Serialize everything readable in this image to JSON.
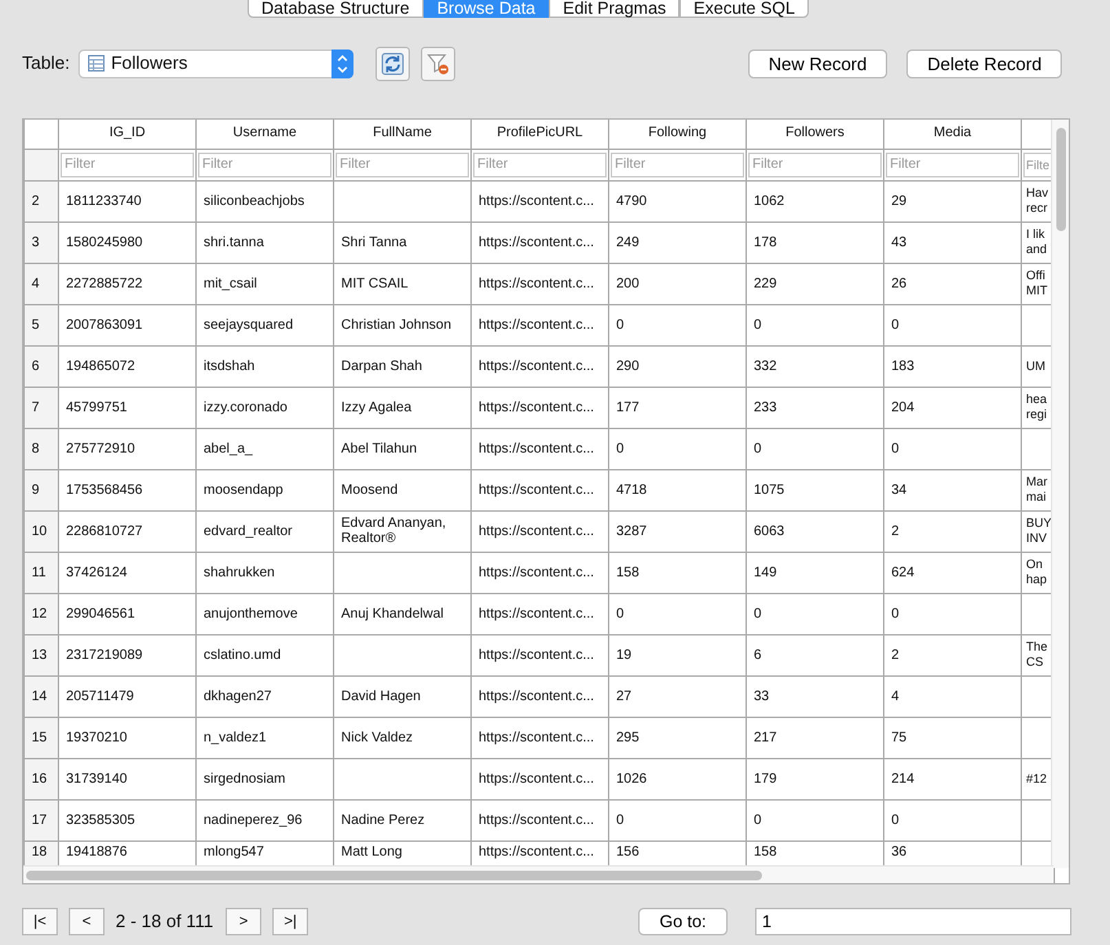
{
  "tabs": [
    {
      "label": "Database Structure",
      "selected": false
    },
    {
      "label": "Browse Data",
      "selected": true
    },
    {
      "label": "Edit Pragmas",
      "selected": false
    },
    {
      "label": "Execute SQL",
      "selected": false
    }
  ],
  "table_picker": {
    "label": "Table:",
    "value": "Followers"
  },
  "buttons": [
    "New Record",
    "Delete Record"
  ],
  "grid": {
    "columns": [
      "IG_ID",
      "Username",
      "FullName",
      "ProfilePicURL",
      "Following",
      "Followers",
      "Media",
      null
    ],
    "filters": [
      {
        "placeholder": "Filter"
      },
      {
        "placeholder": "Filter"
      },
      {
        "placeholder": "Filter"
      },
      {
        "placeholder": "Filter"
      },
      {
        "placeholder": "Filter"
      },
      {
        "placeholder": "Filter"
      },
      {
        "placeholder": "Filter"
      },
      {
        "placeholder": "Filte"
      }
    ],
    "rows": [
      {
        "number": "2",
        "cells": [
          "1811233740",
          "siliconbeachjobs",
          null,
          "https://scontent.c...",
          "4790",
          "1062",
          "29",
          "Hav\nrecr"
        ]
      },
      {
        "number": "3",
        "cells": [
          "1580245980",
          "shri.tanna",
          "Shri Tanna",
          "https://scontent.c...",
          "249",
          "178",
          "43",
          "I lik\nand"
        ]
      },
      {
        "number": "4",
        "cells": [
          "2272885722",
          "mit_csail",
          "MIT CSAIL",
          "https://scontent.c...",
          "200",
          "229",
          "26",
          "Offi\nMIT"
        ]
      },
      {
        "number": "5",
        "cells": [
          "2007863091",
          "seejaysquared",
          "Christian Johnson",
          "https://scontent.c...",
          "0",
          "0",
          "0",
          null
        ]
      },
      {
        "number": "6",
        "cells": [
          "194865072",
          "itsdshah",
          "Darpan Shah",
          "https://scontent.c...",
          "290",
          "332",
          "183",
          "UM"
        ]
      },
      {
        "number": "7",
        "cells": [
          "45799751",
          "izzy.coronado",
          "Izzy Agalea",
          "https://scontent.c...",
          "177",
          "233",
          "204",
          "hea\nregi"
        ]
      },
      {
        "number": "8",
        "cells": [
          "275772910",
          "abel_a_",
          "Abel Tilahun",
          "https://scontent.c...",
          "0",
          "0",
          "0",
          null
        ]
      },
      {
        "number": "9",
        "cells": [
          "1753568456",
          "moosendapp",
          "Moosend",
          "https://scontent.c...",
          "4718",
          "1075",
          "34",
          "Mar\nmai"
        ]
      },
      {
        "number": "10",
        "cells": [
          "2286810727",
          "edvard_realtor",
          "Edvard Ananyan,\nRealtor®",
          "https://scontent.c...",
          "3287",
          "6063",
          "2",
          "BUY\nINV"
        ]
      },
      {
        "number": "11",
        "cells": [
          "37426124",
          "shahrukken",
          null,
          "https://scontent.c...",
          "158",
          "149",
          "624",
          "On\nhap"
        ]
      },
      {
        "number": "12",
        "cells": [
          "299046561",
          "anujonthemove",
          "Anuj Khandelwal",
          "https://scontent.c...",
          "0",
          "0",
          "0",
          null
        ]
      },
      {
        "number": "13",
        "cells": [
          "2317219089",
          "cslatino.umd",
          null,
          "https://scontent.c...",
          "19",
          "6",
          "2",
          "The\nCS"
        ]
      },
      {
        "number": "14",
        "cells": [
          "205711479",
          "dkhagen27",
          "David Hagen",
          "https://scontent.c...",
          "27",
          "33",
          "4",
          null
        ]
      },
      {
        "number": "15",
        "cells": [
          "19370210",
          "n_valdez1",
          "Nick  Valdez",
          "https://scontent.c...",
          "295",
          "217",
          "75",
          null
        ]
      },
      {
        "number": "16",
        "cells": [
          "31739140",
          "sirgednosiam",
          null,
          "https://scontent.c...",
          "1026",
          "179",
          "214",
          "#12"
        ]
      },
      {
        "number": "17",
        "cells": [
          "323585305",
          "nadineperez_96",
          "Nadine Perez",
          "https://scontent.c...",
          "0",
          "0",
          "0",
          null
        ]
      },
      {
        "number": "18",
        "cells": [
          "19418876",
          "mlong547",
          "Matt Long",
          "https://scontent.c...",
          "156",
          "158",
          "36",
          null
        ]
      }
    ]
  },
  "pager": {
    "first": "|<",
    "prev": "<",
    "range": "2 - 18 of 111",
    "next": ">",
    "last": ">|",
    "goto_button": "Go to:",
    "goto_value": "1"
  }
}
